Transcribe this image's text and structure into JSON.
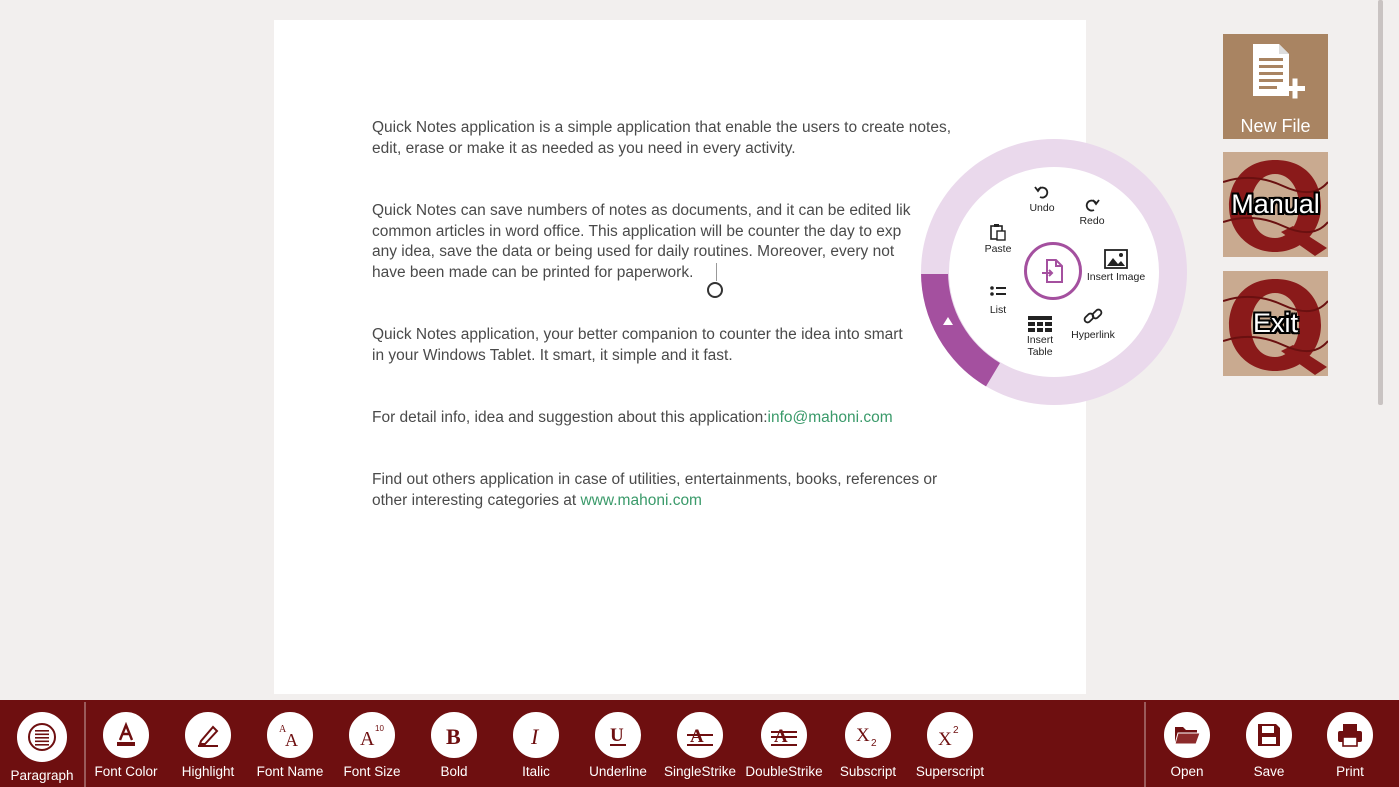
{
  "document": {
    "paragraphs": [
      {
        "lines": [
          "Quick Notes application is a simple application that enable the users to create notes,",
          "edit, erase or make it as needed as you need in every activity."
        ]
      },
      {
        "lines": [
          "Quick Notes can save numbers of notes as documents, and it can be edited lik",
          "common articles in word office. This application will be counter the day to exp",
          "any idea, save the data or being used for daily routines. Moreover, every not",
          "have been made can be printed for paperwork."
        ]
      },
      {
        "lines": [
          "Quick Notes application, your better companion to counter the idea into smart",
          "in your Windows Tablet. It smart, it simple and it fast."
        ]
      },
      {
        "text": "For detail info, idea and suggestion about this application:",
        "link": "info@mahoni.com"
      },
      {
        "line1": "Find out others application in case of utilities, entertainments, books, references or",
        "line2": "other interesting categories at ",
        "link": "www.mahoni.com"
      }
    ]
  },
  "radial_menu": {
    "accent_color": "#a4509f",
    "items": {
      "undo": "Undo",
      "redo": "Redo",
      "paste": "Paste",
      "insert_image": "Insert Image",
      "list": "List",
      "hyperlink": "Hyperlink",
      "insert_table_1": "Insert",
      "insert_table_2": "Table"
    }
  },
  "tiles": {
    "new_file": "New File",
    "manual": "Manual",
    "exit": "Exit"
  },
  "toolbar": {
    "color": "#6e0f10",
    "format_buttons": [
      {
        "label": "Paragraph",
        "icon": "paragraph-icon"
      },
      {
        "label": "Font Color",
        "icon": "font-color-icon"
      },
      {
        "label": "Highlight",
        "icon": "highlight-icon"
      },
      {
        "label": "Font Name",
        "icon": "font-name-icon"
      },
      {
        "label": "Font Size",
        "icon": "font-size-icon"
      },
      {
        "label": "Bold",
        "icon": "bold-icon"
      },
      {
        "label": "Italic",
        "icon": "italic-icon"
      },
      {
        "label": "Underline",
        "icon": "underline-icon"
      },
      {
        "label": "SingleStrike",
        "icon": "single-strike-icon"
      },
      {
        "label": "DoubleStrike",
        "icon": "double-strike-icon"
      },
      {
        "label": "Subscript",
        "icon": "subscript-icon"
      },
      {
        "label": "Superscript",
        "icon": "superscript-icon"
      }
    ],
    "file_buttons": [
      {
        "label": "Open",
        "icon": "folder-icon"
      },
      {
        "label": "Save",
        "icon": "floppy-icon"
      },
      {
        "label": "Print",
        "icon": "printer-icon"
      }
    ]
  }
}
